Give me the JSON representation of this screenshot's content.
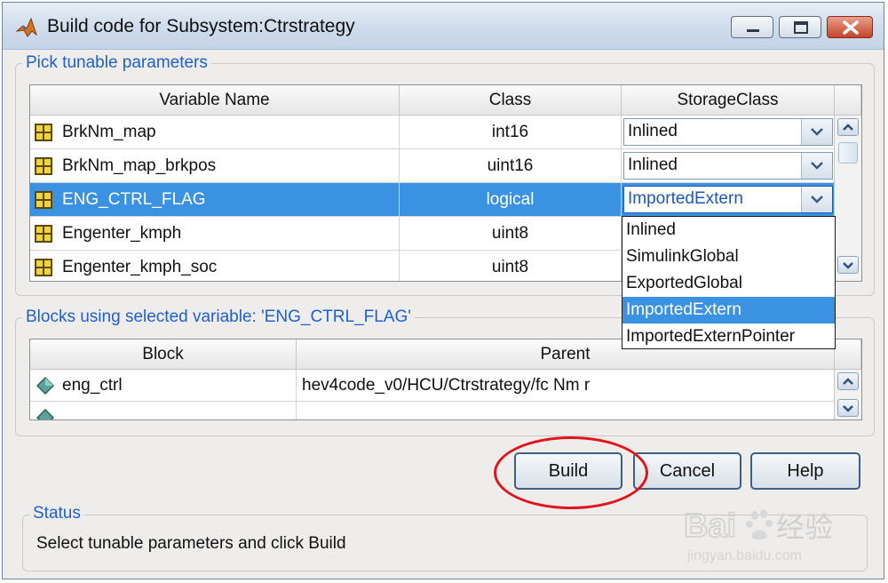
{
  "window": {
    "title": "Build code for Subsystem:Ctrstrategy",
    "icon": "matlab-icon"
  },
  "params_group": {
    "label": "Pick tunable parameters",
    "columns": [
      "Variable Name",
      "Class",
      "StorageClass"
    ],
    "rows": [
      {
        "name": "BrkNm_map",
        "class": "int16",
        "storage": "Inlined",
        "selected": false
      },
      {
        "name": "BrkNm_map_brkpos",
        "class": "uint16",
        "storage": "Inlined",
        "selected": false
      },
      {
        "name": "ENG_CTRL_FLAG",
        "class": "logical",
        "storage": "ImportedExtern",
        "selected": true
      },
      {
        "name": "Engenter_kmph",
        "class": "uint8",
        "storage": "",
        "selected": false
      },
      {
        "name": "Engenter_kmph_soc",
        "class": "uint8",
        "storage": "",
        "selected": false
      }
    ]
  },
  "storage_dropdown": {
    "options": [
      "Inlined",
      "SimulinkGlobal",
      "ExportedGlobal",
      "ImportedExtern",
      "ImportedExternPointer"
    ],
    "highlighted": "ImportedExtern"
  },
  "blocks_group": {
    "label": "Blocks using selected variable: 'ENG_CTRL_FLAG'",
    "columns": [
      "Block",
      "Parent"
    ],
    "rows": [
      {
        "block": "eng_ctrl",
        "parent": "hev4code_v0/HCU/Ctrstrategy/fc Nm r"
      }
    ]
  },
  "buttons": {
    "build": "Build",
    "cancel": "Cancel",
    "help": "Help"
  },
  "status_group": {
    "label": "Status",
    "text": "Select tunable parameters and click Build"
  },
  "watermark": {
    "brand": "Baidu经验",
    "url": "jingyan.baidu.com"
  },
  "colors": {
    "selection": "#3b92e3",
    "group_label": "#1f5fcf",
    "annotation": "#e0141a"
  }
}
